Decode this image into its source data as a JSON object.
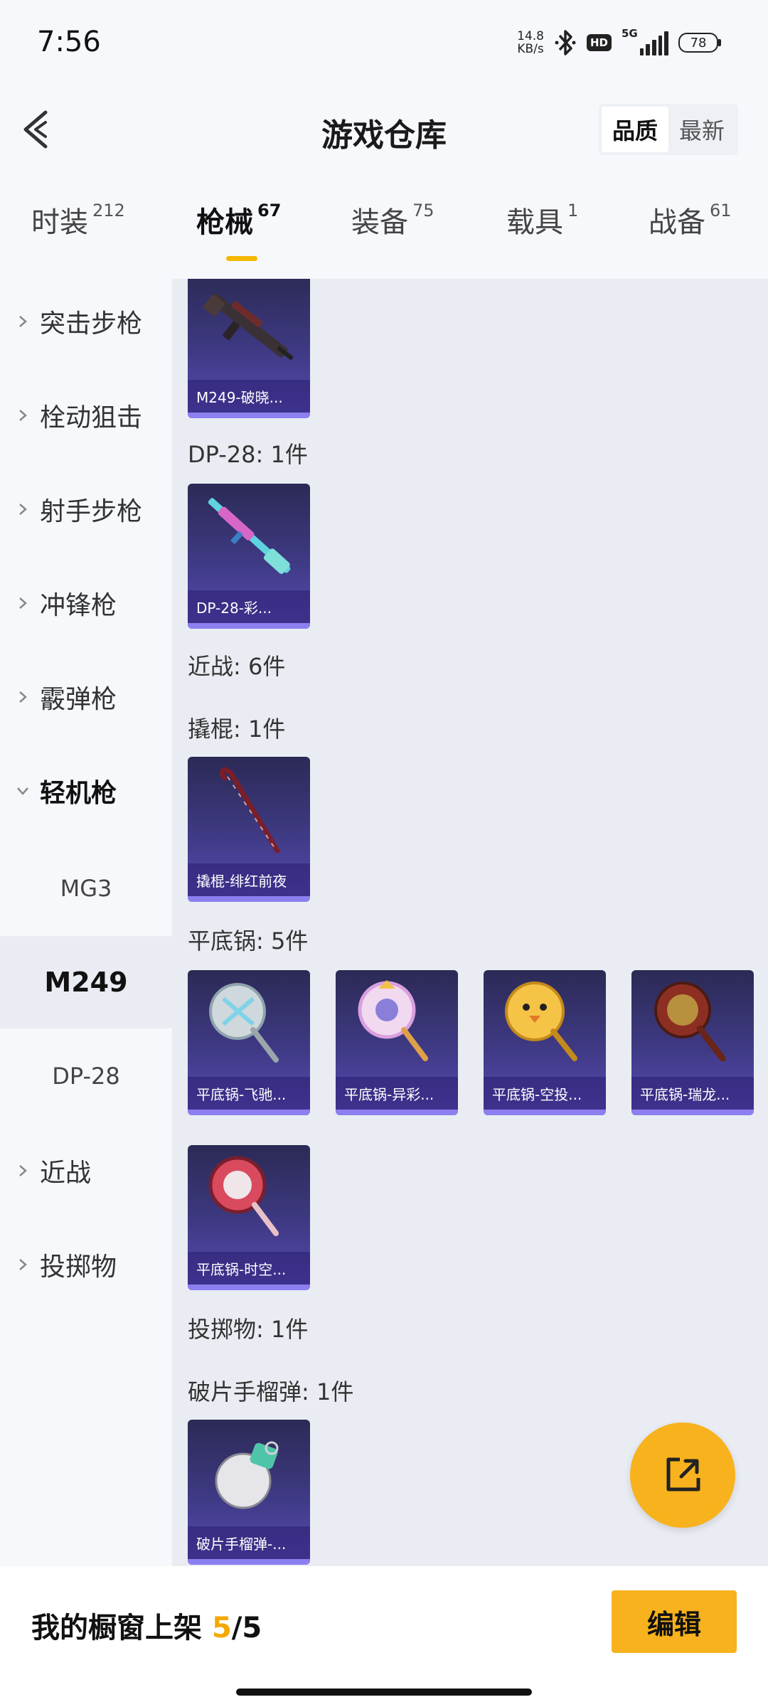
{
  "status_bar": {
    "time": "7:56",
    "net_speed_value": "14.8",
    "net_speed_unit": "KB/s",
    "hd_badge": "HD",
    "signal_label": "5G",
    "battery": "78"
  },
  "header": {
    "title": "游戏仓库",
    "sort_options": [
      "品质",
      "最新"
    ],
    "sort_active": "品质"
  },
  "tabs": [
    {
      "label": "时装",
      "count": "212"
    },
    {
      "label": "枪械",
      "count": "67",
      "active": true
    },
    {
      "label": "装备",
      "count": "75"
    },
    {
      "label": "载具",
      "count": "1"
    },
    {
      "label": "战备",
      "count": "61"
    }
  ],
  "sidebar": {
    "categories": [
      {
        "label": "突击步枪"
      },
      {
        "label": "栓动狙击"
      },
      {
        "label": "射手步枪"
      },
      {
        "label": "冲锋枪"
      },
      {
        "label": "霰弹枪"
      },
      {
        "label": "轻机枪",
        "expanded": true
      },
      {
        "label": "近战"
      },
      {
        "label": "投掷物"
      }
    ],
    "sub_items": [
      {
        "label": "MG3"
      },
      {
        "label": "M249",
        "active": true
      },
      {
        "label": "DP-28"
      }
    ]
  },
  "content": {
    "groups": [
      {
        "header": "",
        "items": [
          {
            "name": "M249-破晓...",
            "icon": "rifle-icon"
          }
        ]
      },
      {
        "header": "DP-28: 1件",
        "items": [
          {
            "name": "DP-28-彩...",
            "icon": "rifle-icon"
          }
        ]
      },
      {
        "header": "近战: 6件",
        "items": []
      },
      {
        "header": "撬棍: 1件",
        "items": [
          {
            "name": "撬棍-绯红前夜",
            "icon": "crowbar-icon"
          }
        ]
      },
      {
        "header": "平底锅: 5件",
        "items": [
          {
            "name": "平底锅-飞驰...",
            "icon": "pan-icon"
          },
          {
            "name": "平底锅-异彩...",
            "icon": "pan-icon"
          },
          {
            "name": "平底锅-空投...",
            "icon": "pan-icon"
          },
          {
            "name": "平底锅-瑞龙...",
            "icon": "pan-icon"
          },
          {
            "name": "平底锅-时空...",
            "icon": "pan-icon"
          }
        ]
      },
      {
        "header": "投掷物: 1件",
        "items": []
      },
      {
        "header": "破片手榴弹: 1件",
        "items": [
          {
            "name": "破片手榴弹-...",
            "icon": "grenade-icon"
          }
        ]
      }
    ]
  },
  "bottom_bar": {
    "showcase_prefix": "我的橱窗上架",
    "showcase_current": "5",
    "showcase_sep": "/",
    "showcase_total": "5",
    "edit_label": "编辑"
  },
  "colors": {
    "accent": "#f7b21d",
    "card_gradient_top": "#2b2a55",
    "card_gradient_bottom": "#5a4cb8"
  }
}
